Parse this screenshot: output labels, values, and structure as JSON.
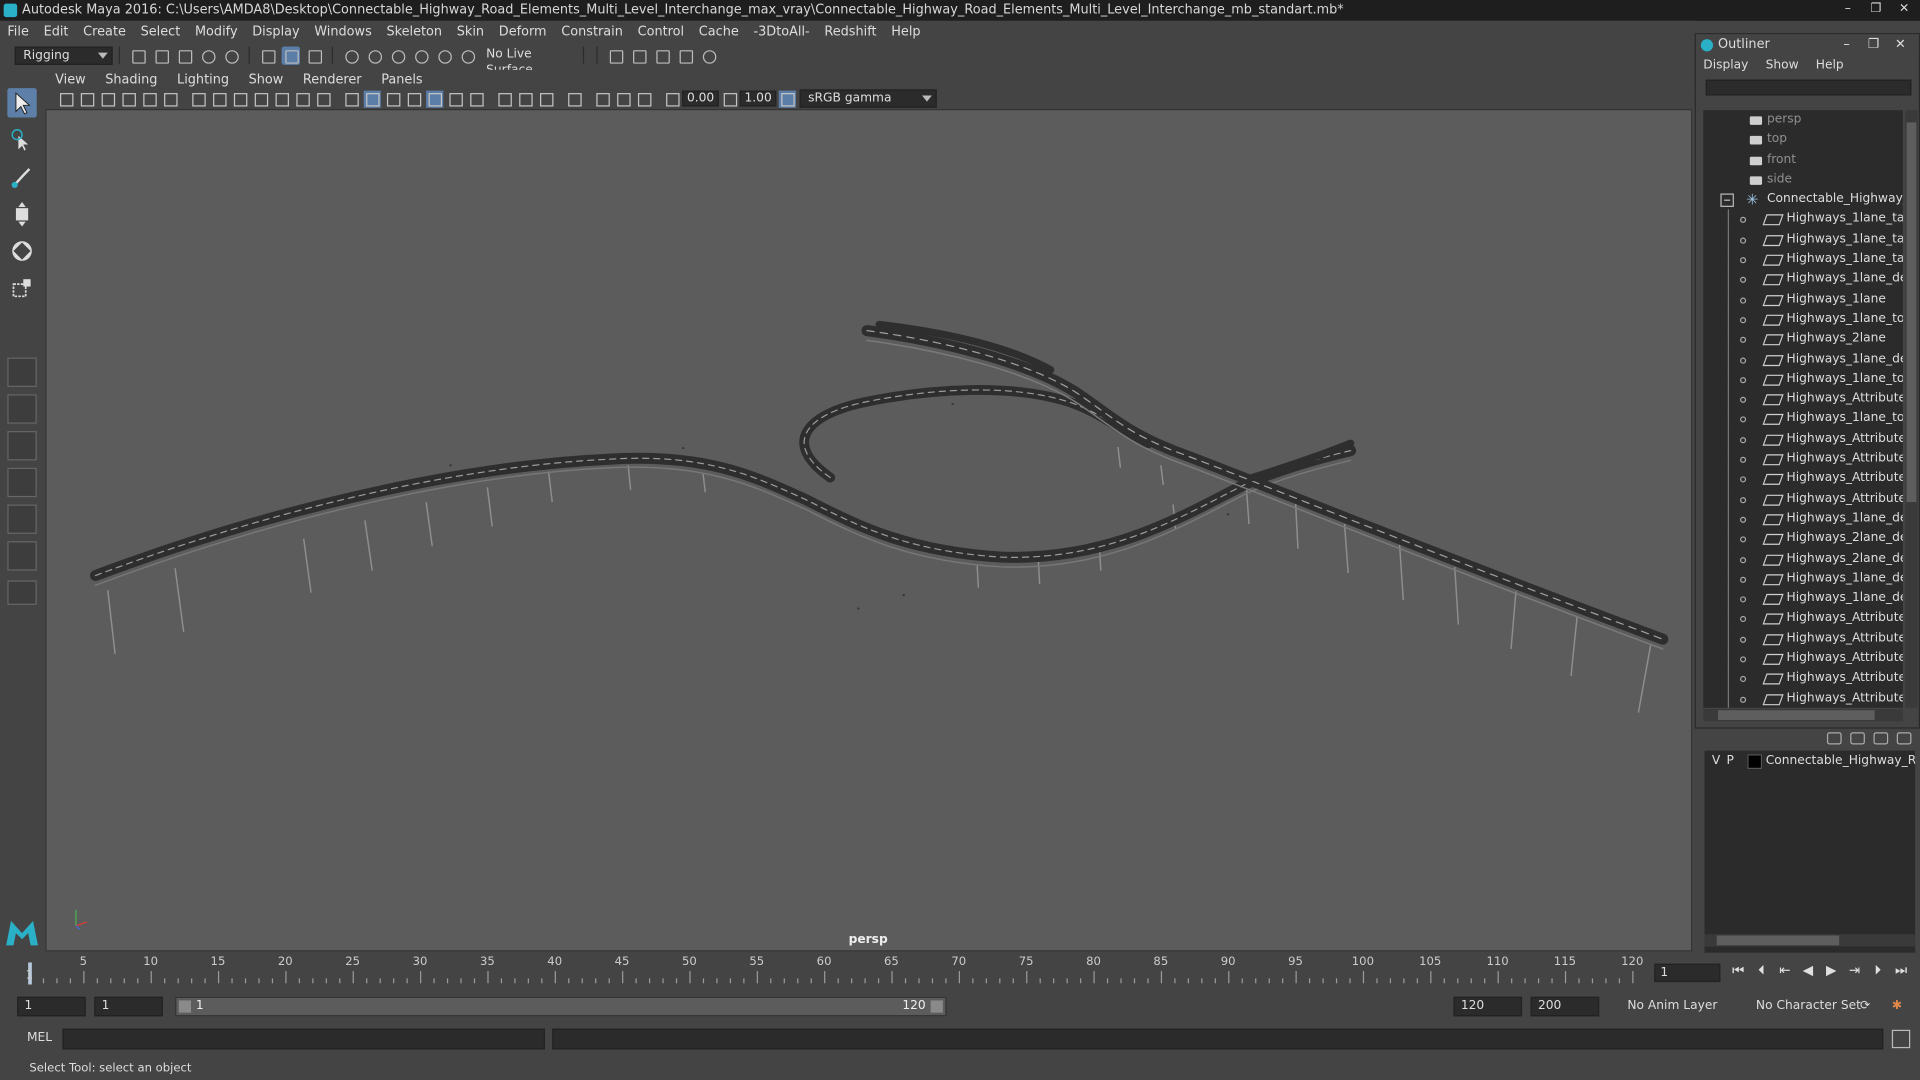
{
  "window": {
    "title": "Autodesk Maya 2016: C:\\Users\\AMDA8\\Desktop\\Connectable_Highway_Road_Elements_Multi_Level_Interchange_max_vray\\Connectable_Highway_Road_Elements_Multi_Level_Interchange_mb_standart.mb*",
    "controls": [
      "–",
      "❐",
      "✕"
    ]
  },
  "menubar": [
    "File",
    "Edit",
    "Create",
    "Select",
    "Modify",
    "Display",
    "Windows",
    "Skeleton",
    "Skin",
    "Deform",
    "Constrain",
    "Control",
    "Cache",
    "-3DtoAll-",
    "Redshift",
    "Help"
  ],
  "statusline": {
    "menuset": "Rigging",
    "live_surface": "No Live Surface"
  },
  "viewport": {
    "menu": [
      "View",
      "Shading",
      "Lighting",
      "Show",
      "Renderer",
      "Panels"
    ],
    "exposure": "0.00",
    "gamma": "1.00",
    "color_space": "sRGB gamma",
    "camera_label": "persp"
  },
  "outliner": {
    "title": "Outliner",
    "menu": [
      "Display",
      "Show",
      "Help"
    ],
    "cameras": [
      "persp",
      "top",
      "front",
      "side"
    ],
    "group": "Connectable_Highway_Ro",
    "items": [
      "Highways_1lane_tall_0",
      "Highways_1lane_tall_0",
      "Highways_1lane_tall",
      "Highways_1lane_desce",
      "Highways_1lane",
      "Highways_1lane_to_2la",
      "Highways_2lane",
      "Highways_1lane_desce",
      "Highways_1lane_to_de",
      "Highways_Attributes_E",
      "Highways_1lane_to_2la",
      "Highways_Attributes_E",
      "Highways_Attributes_E",
      "Highways_Attributes_E",
      "Highways_Attributes_E",
      "Highways_1lane_desce",
      "Highways_2lane_desce",
      "Highways_2lane_desce",
      "Highways_1lane_desce",
      "Highways_1lane_desce",
      "Highways_Attributes_E",
      "Highways_Attributes_E",
      "Highways_Attributes_E",
      "Highways_Attributes_E",
      "Highways_Attributes_E"
    ]
  },
  "layer": {
    "v": "V",
    "p": "P",
    "name": "Connectable_Highway_Road"
  },
  "timeline": {
    "ticks": [
      "5",
      "10",
      "15",
      "20",
      "25",
      "30",
      "35",
      "40",
      "45",
      "50",
      "55",
      "60",
      "65",
      "70",
      "75",
      "80",
      "85",
      "90",
      "95",
      "100",
      "105",
      "110",
      "115",
      "120"
    ],
    "playhead_label": "1",
    "start": 1,
    "end": 120,
    "current_frame": "1"
  },
  "range": {
    "start": "1",
    "playback_start": "1",
    "slider_start": "1",
    "slider_end": "120",
    "playback_end": "120",
    "end": "200",
    "anim_layer": "No Anim Layer",
    "character_set": "No Character Set"
  },
  "command": {
    "label": "MEL"
  },
  "help_line": "Select Tool: select an object",
  "colors": {
    "viewport_bg": "#5c5c5c",
    "ui_bg": "#444444",
    "field_bg": "#2b2b2b",
    "highlight": "#5b7ea8",
    "maya_teal": "#2ab0c7"
  }
}
